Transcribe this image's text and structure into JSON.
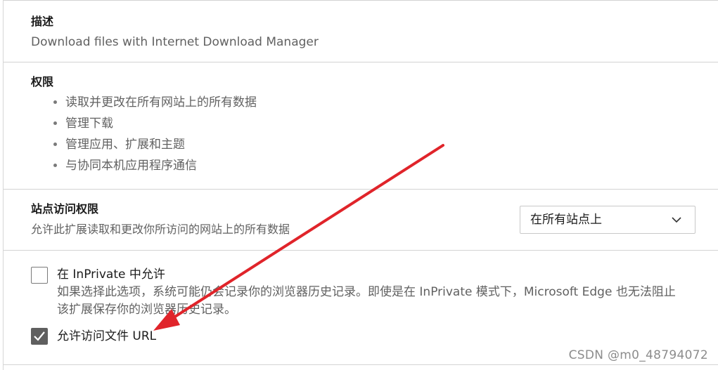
{
  "description": {
    "title": "描述",
    "text": "Download files with Internet Download Manager"
  },
  "permissions": {
    "title": "权限",
    "items": [
      {
        "label": "读取并更改在所有网站上的所有数据"
      },
      {
        "label": "管理下载"
      },
      {
        "label": "管理应用、扩展和主题"
      },
      {
        "label": "与协同本机应用程序通信"
      }
    ]
  },
  "site_access": {
    "title": "站点访问权限",
    "text": "允许此扩展读取和更改你所访问的网站上的所有数据",
    "dropdown": {
      "selected": "在所有站点上",
      "icon": "chevron-down-icon"
    }
  },
  "options": {
    "inprivate": {
      "label": "在 InPrivate 中允许",
      "checked": false,
      "description_line1": "如果选择此选项，系统可能仍会记录你的浏览器历史记录。即使是在 InPrivate 模式下，Microsoft Edge 也无法阻止",
      "description_line2": "该扩展保存你的浏览器历史记录。"
    },
    "file_urls": {
      "label": "允许访问文件 URL",
      "checked": true
    }
  },
  "annotation": {
    "arrow_color": "#e0242a"
  },
  "watermark": {
    "text": "CSDN @m0_48794072"
  },
  "colors": {
    "checkbox_checked": "#5f5f5f",
    "divider": "#d3d3d3",
    "secondary_text": "#616161"
  }
}
